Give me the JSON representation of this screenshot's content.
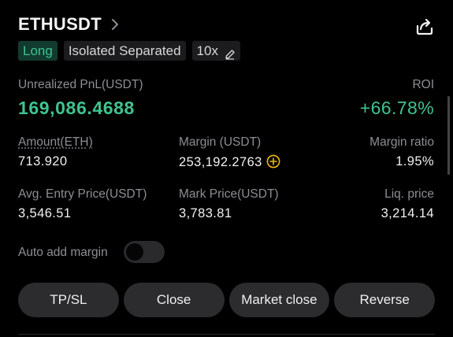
{
  "position": {
    "symbol": "ETHUSDT",
    "side": "Long",
    "margin_mode": "Isolated Separated",
    "leverage": "10x"
  },
  "pnl": {
    "label": "Unrealized PnL(USDT)",
    "value": "169,086.4688",
    "roi_label": "ROI",
    "roi_value": "+66.78%"
  },
  "stats": {
    "amount_label": "Amount(ETH)",
    "amount_value": "713.920",
    "margin_label": "Margin (USDT)",
    "margin_value": "253,192.2763",
    "margin_ratio_label": "Margin ratio",
    "margin_ratio_value": "1.95%",
    "entry_label": "Avg. Entry Price(USDT)",
    "entry_value": "3,546.51",
    "mark_label": "Mark Price(USDT)",
    "mark_value": "3,783.81",
    "liq_label": "Liq. price",
    "liq_value": "3,214.14"
  },
  "auto_margin": {
    "label": "Auto add margin",
    "enabled": false
  },
  "actions": {
    "tpsl": "TP/SL",
    "close": "Close",
    "market_close": "Market close",
    "reverse": "Reverse"
  },
  "colors": {
    "profit": "#3fc38f",
    "accent_yellow": "#f0b90b",
    "button_bg": "#2c2c2e"
  },
  "icons": [
    "chevron-right-icon",
    "share-icon",
    "pencil-icon",
    "plus-circle-icon"
  ]
}
